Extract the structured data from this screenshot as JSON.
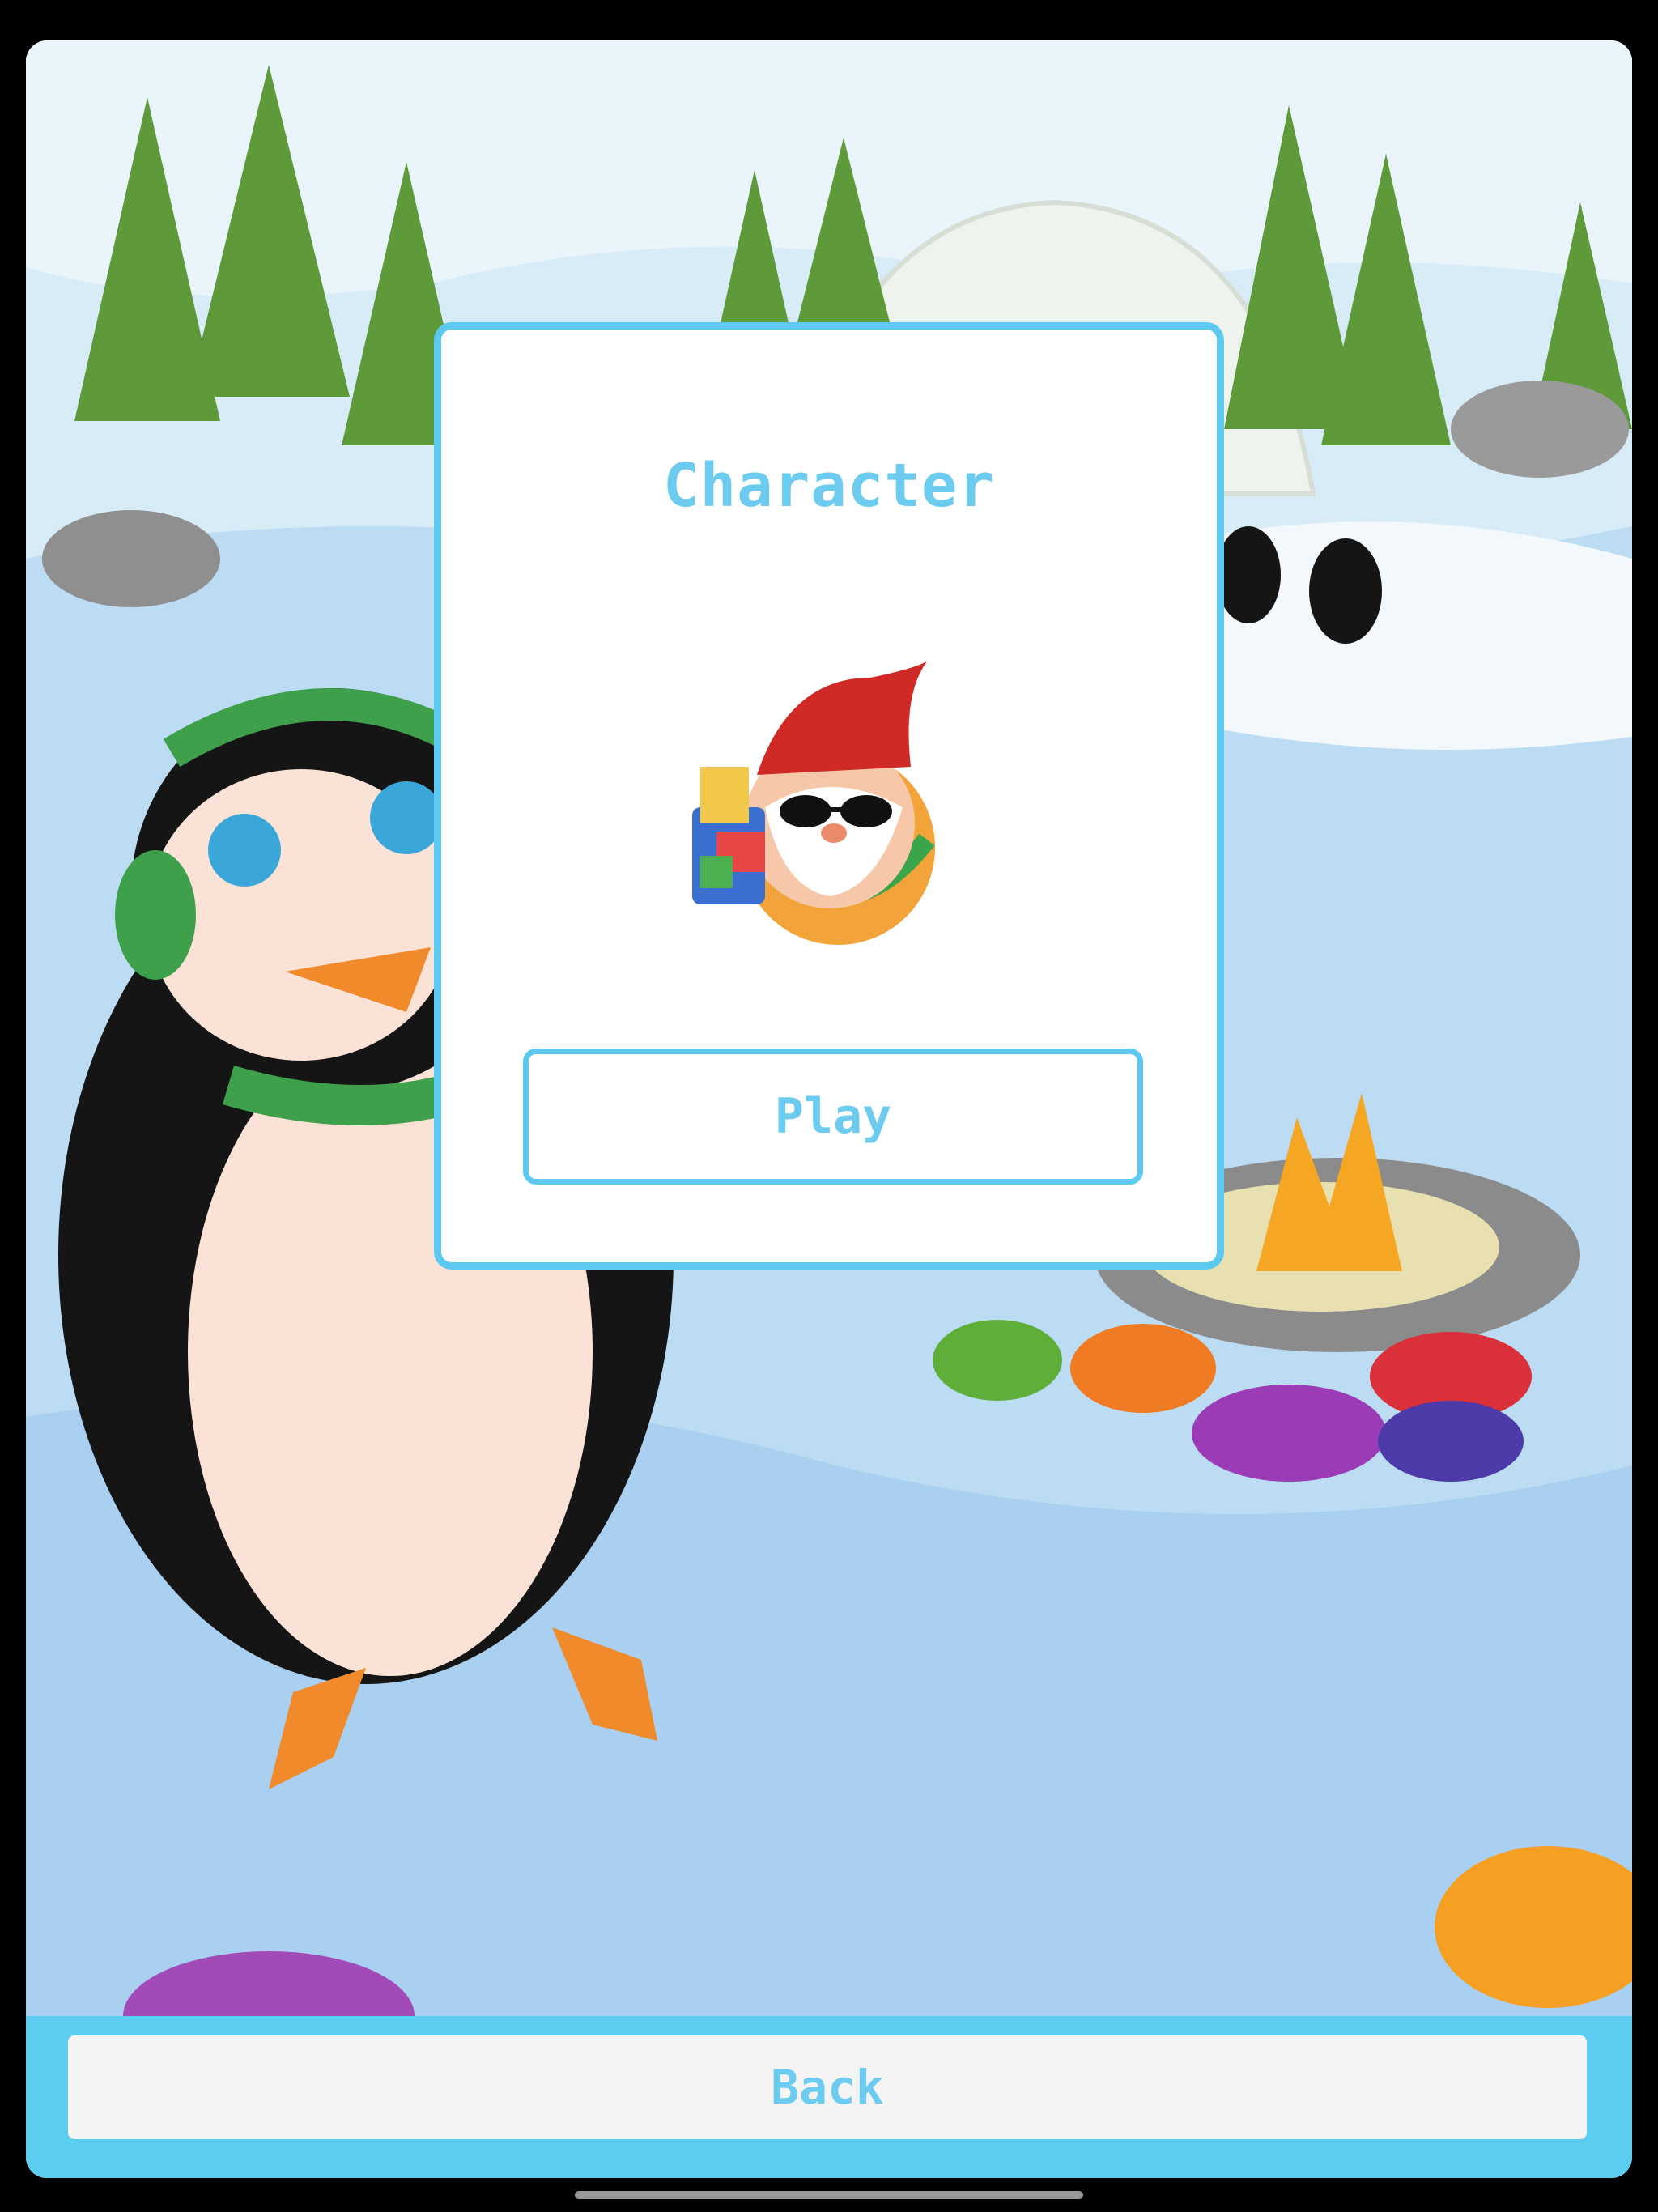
{
  "dialog": {
    "title": "Character",
    "play_label": "Play"
  },
  "footer": {
    "back_label": "Back"
  },
  "colors": {
    "accent": "#5ccaf0",
    "text": "#6ccbef",
    "bar": "#5ccdf0"
  }
}
